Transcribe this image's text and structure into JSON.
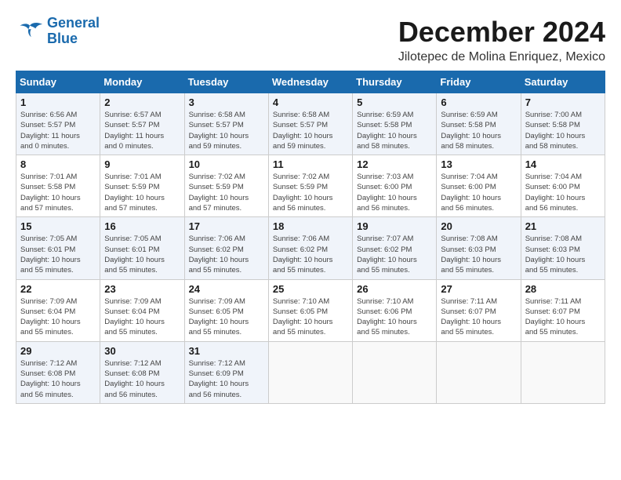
{
  "logo": {
    "line1": "General",
    "line2": "Blue"
  },
  "title": "December 2024",
  "location": "Jilotepec de Molina Enriquez, Mexico",
  "days_of_week": [
    "Sunday",
    "Monday",
    "Tuesday",
    "Wednesday",
    "Thursday",
    "Friday",
    "Saturday"
  ],
  "weeks": [
    [
      {
        "day": 1,
        "info": "Sunrise: 6:56 AM\nSunset: 5:57 PM\nDaylight: 11 hours\nand 0 minutes."
      },
      {
        "day": 2,
        "info": "Sunrise: 6:57 AM\nSunset: 5:57 PM\nDaylight: 11 hours\nand 0 minutes."
      },
      {
        "day": 3,
        "info": "Sunrise: 6:58 AM\nSunset: 5:57 PM\nDaylight: 10 hours\nand 59 minutes."
      },
      {
        "day": 4,
        "info": "Sunrise: 6:58 AM\nSunset: 5:57 PM\nDaylight: 10 hours\nand 59 minutes."
      },
      {
        "day": 5,
        "info": "Sunrise: 6:59 AM\nSunset: 5:58 PM\nDaylight: 10 hours\nand 58 minutes."
      },
      {
        "day": 6,
        "info": "Sunrise: 6:59 AM\nSunset: 5:58 PM\nDaylight: 10 hours\nand 58 minutes."
      },
      {
        "day": 7,
        "info": "Sunrise: 7:00 AM\nSunset: 5:58 PM\nDaylight: 10 hours\nand 58 minutes."
      }
    ],
    [
      {
        "day": 8,
        "info": "Sunrise: 7:01 AM\nSunset: 5:58 PM\nDaylight: 10 hours\nand 57 minutes."
      },
      {
        "day": 9,
        "info": "Sunrise: 7:01 AM\nSunset: 5:59 PM\nDaylight: 10 hours\nand 57 minutes."
      },
      {
        "day": 10,
        "info": "Sunrise: 7:02 AM\nSunset: 5:59 PM\nDaylight: 10 hours\nand 57 minutes."
      },
      {
        "day": 11,
        "info": "Sunrise: 7:02 AM\nSunset: 5:59 PM\nDaylight: 10 hours\nand 56 minutes."
      },
      {
        "day": 12,
        "info": "Sunrise: 7:03 AM\nSunset: 6:00 PM\nDaylight: 10 hours\nand 56 minutes."
      },
      {
        "day": 13,
        "info": "Sunrise: 7:04 AM\nSunset: 6:00 PM\nDaylight: 10 hours\nand 56 minutes."
      },
      {
        "day": 14,
        "info": "Sunrise: 7:04 AM\nSunset: 6:00 PM\nDaylight: 10 hours\nand 56 minutes."
      }
    ],
    [
      {
        "day": 15,
        "info": "Sunrise: 7:05 AM\nSunset: 6:01 PM\nDaylight: 10 hours\nand 55 minutes."
      },
      {
        "day": 16,
        "info": "Sunrise: 7:05 AM\nSunset: 6:01 PM\nDaylight: 10 hours\nand 55 minutes."
      },
      {
        "day": 17,
        "info": "Sunrise: 7:06 AM\nSunset: 6:02 PM\nDaylight: 10 hours\nand 55 minutes."
      },
      {
        "day": 18,
        "info": "Sunrise: 7:06 AM\nSunset: 6:02 PM\nDaylight: 10 hours\nand 55 minutes."
      },
      {
        "day": 19,
        "info": "Sunrise: 7:07 AM\nSunset: 6:02 PM\nDaylight: 10 hours\nand 55 minutes."
      },
      {
        "day": 20,
        "info": "Sunrise: 7:08 AM\nSunset: 6:03 PM\nDaylight: 10 hours\nand 55 minutes."
      },
      {
        "day": 21,
        "info": "Sunrise: 7:08 AM\nSunset: 6:03 PM\nDaylight: 10 hours\nand 55 minutes."
      }
    ],
    [
      {
        "day": 22,
        "info": "Sunrise: 7:09 AM\nSunset: 6:04 PM\nDaylight: 10 hours\nand 55 minutes."
      },
      {
        "day": 23,
        "info": "Sunrise: 7:09 AM\nSunset: 6:04 PM\nDaylight: 10 hours\nand 55 minutes."
      },
      {
        "day": 24,
        "info": "Sunrise: 7:09 AM\nSunset: 6:05 PM\nDaylight: 10 hours\nand 55 minutes."
      },
      {
        "day": 25,
        "info": "Sunrise: 7:10 AM\nSunset: 6:05 PM\nDaylight: 10 hours\nand 55 minutes."
      },
      {
        "day": 26,
        "info": "Sunrise: 7:10 AM\nSunset: 6:06 PM\nDaylight: 10 hours\nand 55 minutes."
      },
      {
        "day": 27,
        "info": "Sunrise: 7:11 AM\nSunset: 6:07 PM\nDaylight: 10 hours\nand 55 minutes."
      },
      {
        "day": 28,
        "info": "Sunrise: 7:11 AM\nSunset: 6:07 PM\nDaylight: 10 hours\nand 55 minutes."
      }
    ],
    [
      {
        "day": 29,
        "info": "Sunrise: 7:12 AM\nSunset: 6:08 PM\nDaylight: 10 hours\nand 56 minutes."
      },
      {
        "day": 30,
        "info": "Sunrise: 7:12 AM\nSunset: 6:08 PM\nDaylight: 10 hours\nand 56 minutes."
      },
      {
        "day": 31,
        "info": "Sunrise: 7:12 AM\nSunset: 6:09 PM\nDaylight: 10 hours\nand 56 minutes."
      },
      null,
      null,
      null,
      null
    ]
  ]
}
